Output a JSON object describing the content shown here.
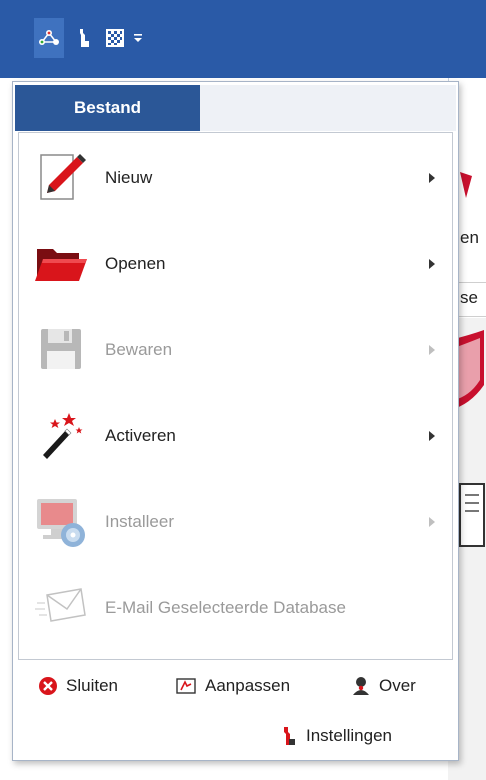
{
  "menu": {
    "tab_label": "Bestand",
    "items": [
      {
        "label": "Nieuw",
        "icon": "new-document-pencil-icon",
        "enabled": true
      },
      {
        "label": "Openen",
        "icon": "folder-open-icon",
        "enabled": true
      },
      {
        "label": "Bewaren",
        "icon": "floppy-disk-icon",
        "enabled": false
      },
      {
        "label": "Activeren",
        "icon": "magic-wand-icon",
        "enabled": true
      },
      {
        "label": "Installeer",
        "icon": "install-monitor-disc-icon",
        "enabled": false
      },
      {
        "label": "E-Mail Geselecteerde Database",
        "icon": "email-envelope-icon",
        "enabled": false
      }
    ],
    "footer": {
      "close": "Sluiten",
      "customize": "Aanpassen",
      "about": "Over",
      "settings": "Instellingen"
    }
  },
  "background": {
    "partial_text_1": "en",
    "partial_text_2": "se"
  },
  "colors": {
    "titlebar": "#2a5aa7",
    "tab_active": "#2b5797",
    "disabled_text": "#9a9a9a"
  }
}
